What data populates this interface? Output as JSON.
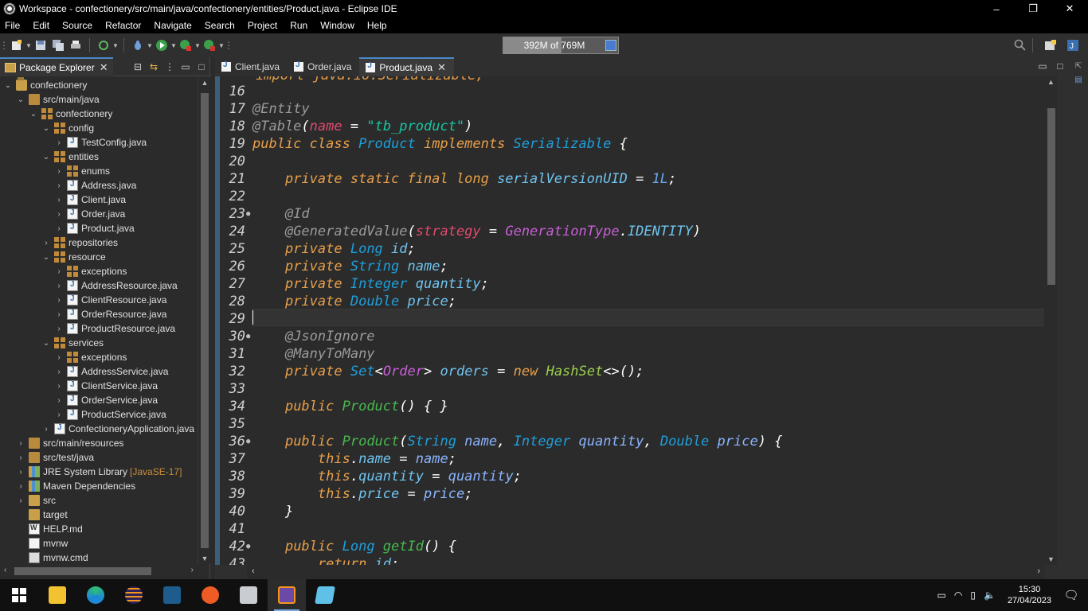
{
  "window": {
    "title": "Workspace - confectionery/src/main/java/confectionery/entities/Product.java - Eclipse IDE",
    "minimize": "–",
    "restore": "❐",
    "close": "✕"
  },
  "menu": [
    "File",
    "Edit",
    "Source",
    "Refactor",
    "Navigate",
    "Search",
    "Project",
    "Run",
    "Window",
    "Help"
  ],
  "heap": {
    "label": "392M of 769M",
    "used_fraction": 0.51
  },
  "package_explorer": {
    "tab_label": "Package Explorer",
    "tree": [
      {
        "label": "confectionery",
        "icon": "project-icon",
        "depth": 0,
        "twisty": "⌄"
      },
      {
        "label": "src/main/java",
        "icon": "folder-src-icon",
        "depth": 1,
        "twisty": "⌄"
      },
      {
        "label": "confectionery",
        "icon": "package-icon",
        "depth": 2,
        "twisty": "⌄"
      },
      {
        "label": "config",
        "icon": "package-icon",
        "depth": 3,
        "twisty": "⌄"
      },
      {
        "label": "TestConfig.java",
        "icon": "java-file-icon",
        "depth": 4,
        "twisty": "›"
      },
      {
        "label": "entities",
        "icon": "package-icon",
        "depth": 3,
        "twisty": "⌄"
      },
      {
        "label": "enums",
        "icon": "package-icon",
        "depth": 4,
        "twisty": "›"
      },
      {
        "label": "Address.java",
        "icon": "java-file-icon",
        "depth": 4,
        "twisty": "›"
      },
      {
        "label": "Client.java",
        "icon": "java-file-icon",
        "depth": 4,
        "twisty": "›"
      },
      {
        "label": "Order.java",
        "icon": "java-file-icon",
        "depth": 4,
        "twisty": "›"
      },
      {
        "label": "Product.java",
        "icon": "java-file-icon",
        "depth": 4,
        "twisty": "›"
      },
      {
        "label": "repositories",
        "icon": "package-icon",
        "depth": 3,
        "twisty": "›"
      },
      {
        "label": "resource",
        "icon": "package-icon",
        "depth": 3,
        "twisty": "⌄"
      },
      {
        "label": "exceptions",
        "icon": "package-icon",
        "depth": 4,
        "twisty": "›"
      },
      {
        "label": "AddressResource.java",
        "icon": "java-file-icon",
        "depth": 4,
        "twisty": "›"
      },
      {
        "label": "ClientResource.java",
        "icon": "java-file-icon",
        "depth": 4,
        "twisty": "›"
      },
      {
        "label": "OrderResource.java",
        "icon": "java-file-icon",
        "depth": 4,
        "twisty": "›"
      },
      {
        "label": "ProductResource.java",
        "icon": "java-file-icon",
        "depth": 4,
        "twisty": "›"
      },
      {
        "label": "services",
        "icon": "package-icon",
        "depth": 3,
        "twisty": "⌄"
      },
      {
        "label": "exceptions",
        "icon": "package-icon",
        "depth": 4,
        "twisty": "›"
      },
      {
        "label": "AddressService.java",
        "icon": "java-file-icon",
        "depth": 4,
        "twisty": "›"
      },
      {
        "label": "ClientService.java",
        "icon": "java-file-icon",
        "depth": 4,
        "twisty": "›"
      },
      {
        "label": "OrderService.java",
        "icon": "java-file-icon",
        "depth": 4,
        "twisty": "›"
      },
      {
        "label": "ProductService.java",
        "icon": "java-file-icon",
        "depth": 4,
        "twisty": "›"
      },
      {
        "label": "ConfectioneryApplication.java",
        "icon": "java-file-icon",
        "depth": 3,
        "twisty": "›"
      },
      {
        "label": "src/main/resources",
        "icon": "folder-src-icon",
        "depth": 1,
        "twisty": "›"
      },
      {
        "label": "src/test/java",
        "icon": "folder-src-icon",
        "depth": 1,
        "twisty": "›"
      },
      {
        "label": "JRE System Library",
        "suffix": "[JavaSE-17]",
        "icon": "library-icon",
        "depth": 1,
        "twisty": "›"
      },
      {
        "label": "Maven Dependencies",
        "icon": "library-icon",
        "depth": 1,
        "twisty": "›"
      },
      {
        "label": "src",
        "icon": "folder-icon",
        "depth": 1,
        "twisty": "›"
      },
      {
        "label": "target",
        "icon": "folder-icon",
        "depth": 1,
        "twisty": ""
      },
      {
        "label": "HELP.md",
        "icon": "markdown-file-icon",
        "depth": 1,
        "twisty": ""
      },
      {
        "label": "mvnw",
        "icon": "file-icon",
        "depth": 1,
        "twisty": ""
      },
      {
        "label": "mvnw.cmd",
        "icon": "cmd-file-icon",
        "depth": 1,
        "twisty": ""
      }
    ]
  },
  "editor": {
    "tabs": [
      {
        "label": "Client.java",
        "active": false
      },
      {
        "label": "Order.java",
        "active": false
      },
      {
        "label": "Product.java",
        "active": true
      }
    ],
    "partial_top_line": "import java.io.Serializable;",
    "lines": [
      {
        "n": "16",
        "fold": "",
        "tokens": []
      },
      {
        "n": "17",
        "fold": "",
        "tokens": [
          [
            "an",
            "@Entity"
          ]
        ]
      },
      {
        "n": "18",
        "fold": "",
        "tokens": [
          [
            "an",
            "@Table"
          ],
          [
            "pu",
            "("
          ],
          [
            "pk",
            "name"
          ],
          [
            "pu",
            " = "
          ],
          [
            "st",
            "\"tb_product\""
          ],
          [
            "pu",
            ")"
          ]
        ]
      },
      {
        "n": "19",
        "fold": "",
        "tokens": [
          [
            "kw",
            "public class "
          ],
          [
            "ty",
            "Product "
          ],
          [
            "kw",
            "implements "
          ],
          [
            "ty",
            "Serializable "
          ],
          [
            "pu",
            "{"
          ]
        ]
      },
      {
        "n": "20",
        "fold": "",
        "tokens": []
      },
      {
        "n": "21",
        "fold": "",
        "tokens": [
          [
            "pu",
            "    "
          ],
          [
            "kw",
            "private static final long "
          ],
          [
            "fd",
            "serialVersionUID"
          ],
          [
            "pu",
            " = "
          ],
          [
            "num",
            "1L"
          ],
          [
            "pu",
            ";"
          ]
        ]
      },
      {
        "n": "22",
        "fold": "",
        "tokens": []
      },
      {
        "n": "23",
        "fold": "●",
        "tokens": [
          [
            "pu",
            "    "
          ],
          [
            "an",
            "@Id"
          ]
        ]
      },
      {
        "n": "24",
        "fold": "",
        "tokens": [
          [
            "pu",
            "    "
          ],
          [
            "an",
            "@GeneratedValue"
          ],
          [
            "pu",
            "("
          ],
          [
            "pk",
            "strategy"
          ],
          [
            "pu",
            " = "
          ],
          [
            "vi",
            "GenerationType"
          ],
          [
            "pu",
            "."
          ],
          [
            "fd",
            "IDENTITY"
          ],
          [
            "pu",
            ")"
          ]
        ]
      },
      {
        "n": "25",
        "fold": "",
        "tokens": [
          [
            "pu",
            "    "
          ],
          [
            "kw",
            "private "
          ],
          [
            "ty",
            "Long "
          ],
          [
            "fd",
            "id"
          ],
          [
            "pu",
            ";"
          ]
        ]
      },
      {
        "n": "26",
        "fold": "",
        "tokens": [
          [
            "pu",
            "    "
          ],
          [
            "kw",
            "private "
          ],
          [
            "ty",
            "String "
          ],
          [
            "fd",
            "name"
          ],
          [
            "pu",
            ";"
          ]
        ]
      },
      {
        "n": "27",
        "fold": "",
        "tokens": [
          [
            "pu",
            "    "
          ],
          [
            "kw",
            "private "
          ],
          [
            "ty",
            "Integer "
          ],
          [
            "fd",
            "quantity"
          ],
          [
            "pu",
            ";"
          ]
        ]
      },
      {
        "n": "28",
        "fold": "",
        "tokens": [
          [
            "pu",
            "    "
          ],
          [
            "kw",
            "private "
          ],
          [
            "ty",
            "Double "
          ],
          [
            "fd",
            "price"
          ],
          [
            "pu",
            ";"
          ]
        ]
      },
      {
        "n": "29",
        "fold": "",
        "tokens": [],
        "caret": true
      },
      {
        "n": "30",
        "fold": "●",
        "tokens": [
          [
            "pu",
            "    "
          ],
          [
            "an",
            "@JsonIgnore"
          ]
        ]
      },
      {
        "n": "31",
        "fold": "",
        "tokens": [
          [
            "pu",
            "    "
          ],
          [
            "an",
            "@ManyToMany"
          ]
        ]
      },
      {
        "n": "32",
        "fold": "",
        "tokens": [
          [
            "pu",
            "    "
          ],
          [
            "kw",
            "private "
          ],
          [
            "ty",
            "Set"
          ],
          [
            "pu",
            "<"
          ],
          [
            "vi",
            "Order"
          ],
          [
            "pu",
            "> "
          ],
          [
            "fd",
            "orders"
          ],
          [
            "pu",
            " = "
          ],
          [
            "kw",
            "new "
          ],
          [
            "cls",
            "HashSet"
          ],
          [
            "pu",
            "<>();"
          ]
        ]
      },
      {
        "n": "33",
        "fold": "",
        "tokens": []
      },
      {
        "n": "34",
        "fold": "",
        "tokens": [
          [
            "pu",
            "    "
          ],
          [
            "kw",
            "public "
          ],
          [
            "nm",
            "Product"
          ],
          [
            "pu",
            "() { }"
          ]
        ]
      },
      {
        "n": "35",
        "fold": "",
        "tokens": []
      },
      {
        "n": "36",
        "fold": "●",
        "tokens": [
          [
            "pu",
            "    "
          ],
          [
            "kw",
            "public "
          ],
          [
            "nm",
            "Product"
          ],
          [
            "pu",
            "("
          ],
          [
            "ty",
            "String "
          ],
          [
            "pa",
            "name"
          ],
          [
            "pu",
            ", "
          ],
          [
            "ty",
            "Integer "
          ],
          [
            "pa",
            "quantity"
          ],
          [
            "pu",
            ", "
          ],
          [
            "ty",
            "Double "
          ],
          [
            "pa",
            "price"
          ],
          [
            "pu",
            ") {"
          ]
        ]
      },
      {
        "n": "37",
        "fold": "",
        "tokens": [
          [
            "pu",
            "        "
          ],
          [
            "kw",
            "this"
          ],
          [
            "pu",
            "."
          ],
          [
            "fd",
            "name"
          ],
          [
            "pu",
            " = "
          ],
          [
            "pa",
            "name"
          ],
          [
            "pu",
            ";"
          ]
        ]
      },
      {
        "n": "38",
        "fold": "",
        "tokens": [
          [
            "pu",
            "        "
          ],
          [
            "kw",
            "this"
          ],
          [
            "pu",
            "."
          ],
          [
            "fd",
            "quantity"
          ],
          [
            "pu",
            " = "
          ],
          [
            "pa",
            "quantity"
          ],
          [
            "pu",
            ";"
          ]
        ]
      },
      {
        "n": "39",
        "fold": "",
        "tokens": [
          [
            "pu",
            "        "
          ],
          [
            "kw",
            "this"
          ],
          [
            "pu",
            "."
          ],
          [
            "fd",
            "price"
          ],
          [
            "pu",
            " = "
          ],
          [
            "pa",
            "price"
          ],
          [
            "pu",
            ";"
          ]
        ]
      },
      {
        "n": "40",
        "fold": "",
        "tokens": [
          [
            "pu",
            "    }"
          ]
        ]
      },
      {
        "n": "41",
        "fold": "",
        "tokens": []
      },
      {
        "n": "42",
        "fold": "●",
        "tokens": [
          [
            "pu",
            "    "
          ],
          [
            "kw",
            "public "
          ],
          [
            "ty",
            "Long "
          ],
          [
            "nm",
            "getId"
          ],
          [
            "pu",
            "() {"
          ]
        ]
      },
      {
        "n": "43",
        "fold": "",
        "tokens": [
          [
            "pu",
            "        "
          ],
          [
            "kw",
            "return "
          ],
          [
            "fd",
            "id"
          ],
          [
            "pu",
            ";"
          ]
        ]
      }
    ]
  },
  "taskbar": {
    "clock_time": "15:30",
    "clock_date": "27/04/2023"
  }
}
